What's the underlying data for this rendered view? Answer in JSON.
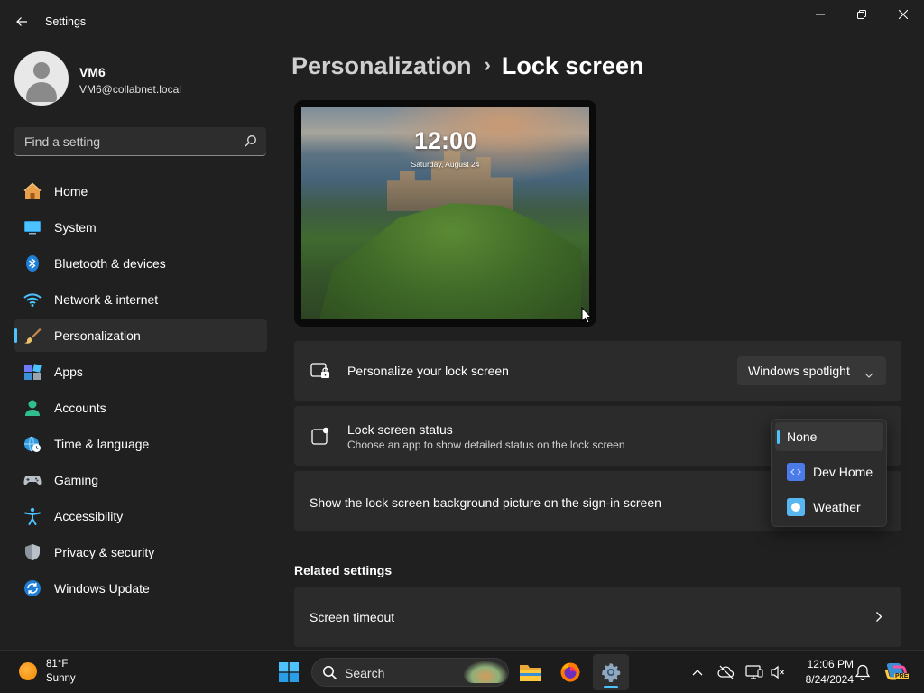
{
  "window": {
    "title": "Settings"
  },
  "user": {
    "name": "VM6",
    "email": "VM6@collabnet.local"
  },
  "search": {
    "placeholder": "Find a setting"
  },
  "sidebar": {
    "items": [
      {
        "label": "Home",
        "icon": "home-icon"
      },
      {
        "label": "System",
        "icon": "monitor-icon"
      },
      {
        "label": "Bluetooth & devices",
        "icon": "bluetooth-icon"
      },
      {
        "label": "Network & internet",
        "icon": "wifi-icon"
      },
      {
        "label": "Personalization",
        "icon": "brush-icon",
        "active": true
      },
      {
        "label": "Apps",
        "icon": "apps-icon"
      },
      {
        "label": "Accounts",
        "icon": "person-icon"
      },
      {
        "label": "Time & language",
        "icon": "globe-clock-icon"
      },
      {
        "label": "Gaming",
        "icon": "gamepad-icon"
      },
      {
        "label": "Accessibility",
        "icon": "accessibility-icon"
      },
      {
        "label": "Privacy & security",
        "icon": "shield-icon"
      },
      {
        "label": "Windows Update",
        "icon": "update-icon"
      }
    ]
  },
  "breadcrumb": {
    "parent": "Personalization",
    "separator": "›",
    "current": "Lock screen"
  },
  "preview": {
    "time": "12:00",
    "date": "Saturday, August 24"
  },
  "settings": {
    "personalize": {
      "title": "Personalize your lock screen",
      "value": "Windows spotlight"
    },
    "status": {
      "title": "Lock screen status",
      "subtitle": "Choose an app to show detailed status on the lock screen",
      "options": [
        "None",
        "Dev Home",
        "Weather"
      ],
      "selected": "None"
    },
    "signin": {
      "title": "Show the lock screen background picture on the sign-in screen"
    }
  },
  "related": {
    "heading": "Related settings",
    "items": [
      {
        "label": "Screen timeout"
      }
    ]
  },
  "taskbar": {
    "weather_temp": "81°F",
    "weather_desc": "Sunny",
    "search_label": "Search",
    "time": "12:06 PM",
    "date": "8/24/2024",
    "copilot_badge": "PRE"
  },
  "colors": {
    "accent": "#4cc2ff",
    "background": "#202020",
    "card": "#2b2b2b"
  }
}
